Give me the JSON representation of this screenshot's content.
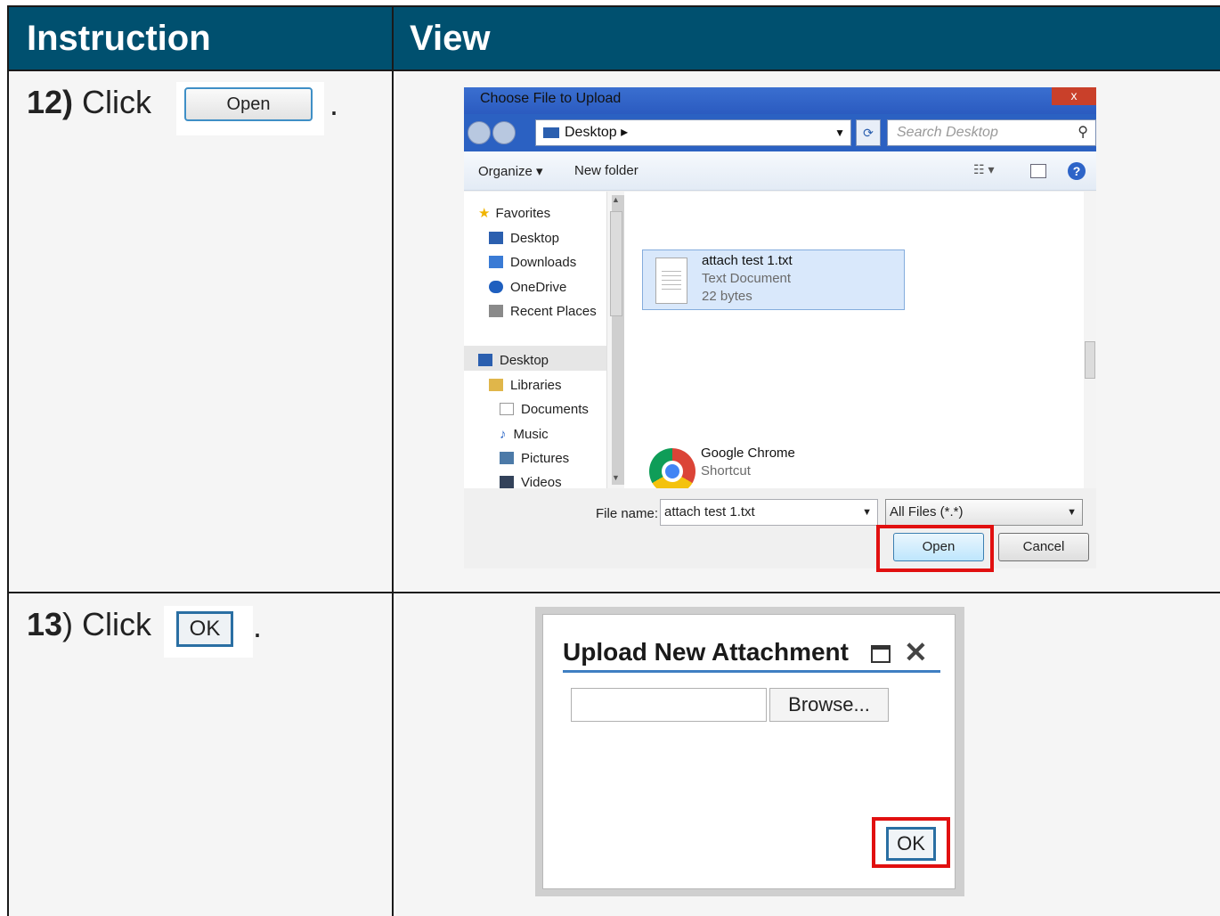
{
  "table": {
    "headers": [
      "Instruction",
      "View"
    ]
  },
  "steps": [
    {
      "number": "12)",
      "verb": "Click",
      "button_label": "Open",
      "period": "."
    },
    {
      "number": "13",
      "suffix": ")",
      "verb": "Click",
      "button_label": "OK",
      "period": "."
    }
  ],
  "file_dialog": {
    "title": "Choose File to Upload",
    "close_symbol": "x",
    "address": "Desktop",
    "search_placeholder": "Search Desktop",
    "toolbar": {
      "organize": "Organize ▾",
      "new_folder": "New folder",
      "help": "?"
    },
    "nav": [
      {
        "label": "Favorites",
        "icon": "star-icon",
        "color": "#f0b400"
      },
      {
        "label": "Desktop",
        "icon": "desktop-icon",
        "color": "#2b5faf"
      },
      {
        "label": "Downloads",
        "icon": "downloads-icon",
        "color": "#3a7bd5"
      },
      {
        "label": "OneDrive",
        "icon": "cloud-icon",
        "color": "#1f5fbf"
      },
      {
        "label": "Recent Places",
        "icon": "recent-icon",
        "color": "#8a8a8a"
      },
      {
        "label": "Desktop",
        "icon": "desktop-icon",
        "color": "#2b5faf"
      },
      {
        "label": "Libraries",
        "icon": "folder-icon",
        "color": "#e0b64a"
      },
      {
        "label": "Documents",
        "icon": "document-icon",
        "color": "#bbbbbb"
      },
      {
        "label": "Music",
        "icon": "music-icon",
        "color": "#2c67c7"
      },
      {
        "label": "Pictures",
        "icon": "pictures-icon",
        "color": "#4c7aa8"
      },
      {
        "label": "Videos",
        "icon": "videos-icon",
        "color": "#33425a"
      }
    ],
    "files": [
      {
        "name": "attach test 1.txt",
        "type": "Text Document",
        "size": "22 bytes"
      },
      {
        "name": "Google Chrome",
        "type": "Shortcut"
      }
    ],
    "filename_label": "File name:",
    "filename_value": "attach test 1.txt",
    "filetype_value": "All Files (*.*)",
    "open_label": "Open",
    "cancel_label": "Cancel"
  },
  "upload_dialog": {
    "title": "Upload New Attachment",
    "browse_label": "Browse...",
    "ok_label": "OK"
  },
  "colors": {
    "header_bg": "#00506f",
    "highlight": "#e11010",
    "accent": "#3f7fc2"
  }
}
